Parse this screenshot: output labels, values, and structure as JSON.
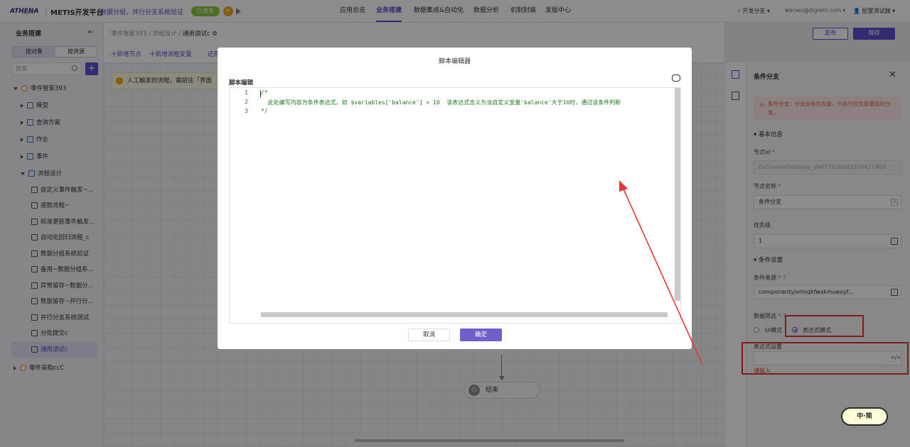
{
  "header": {
    "logo_text": "ATHENA",
    "logo_sub": "DigiWin",
    "platform": "METIS开发平台",
    "subtitle": "数据分组，并行分支系统验证",
    "status_badge": "已发布",
    "nav": [
      "应用总览",
      "业务搭建",
      "数据集成&自动化",
      "数据分析",
      "机制封装",
      "发版中心"
    ],
    "active_nav": "业务搭建",
    "branch": "开发分支",
    "user_email": "wenwu@digiwin.com",
    "tester": "配置测试器"
  },
  "sidebar": {
    "title": "业务搭建",
    "seg_a": "按对象",
    "seg_b": "按资源",
    "search_placeholder": "搜索",
    "root": "零件管家393",
    "items": [
      {
        "label": "模型"
      },
      {
        "label": "查询方案"
      },
      {
        "label": "作业"
      },
      {
        "label": "事件"
      },
      {
        "label": "流程设计"
      }
    ],
    "flows": [
      "自定义事件触发~...",
      "退数流程~",
      "标准更新事件触发...",
      "自动化回归流程_c",
      "数据分组系统验证",
      "备用~数据分组系...",
      "异常留存~数据分...",
      "数据留存~并行分...",
      "并行分支系统测试",
      "分批提交c",
      "通用调试c"
    ],
    "selected_flow": "通用调试c",
    "root2": "零件采购ccC"
  },
  "main": {
    "breadcrumb_1": "零件管家393",
    "breadcrumb_2": "流程设计",
    "breadcrumb_3": "通用调试c",
    "add_node": "十新增节点",
    "add_var": "十新增流程变量",
    "more_link": "还原",
    "warn_text": "人工触发的流程，需前往「界面",
    "end_node": "结束",
    "publish_btn": "发布",
    "save_btn": "保存"
  },
  "panel": {
    "title": "条件分支",
    "warning": "条件分支：分支间有优先级，只执行优先级最高的分支。",
    "basic_info": "基本信息",
    "node_id_label": "节点id",
    "node_id": "ExclusiveGateway_dfef7703bb85200421989",
    "node_name_label": "节点名称",
    "node_name": "条件分支",
    "priority_label": "优先级",
    "priority": "1",
    "cond_settings": "条件设置",
    "cond_source_label": "条件来源",
    "cond_source": "componentyjvrmqkfwxkmueoyf...",
    "filter_label": "数据筛选",
    "mode_ui": "UI模式",
    "mode_expr": "表达式模式",
    "expr_label": "表达式设置",
    "expr_hint": "请输入"
  },
  "dialog": {
    "title": "脚本编辑器",
    "section": "脚本编辑",
    "line_numbers": [
      "1",
      "2",
      "3"
    ],
    "code_lines": [
      "/*",
      "  此处编写内容为条件表达式，如 $variables['balance'] > 10  该表达式含义为当自定义变量'balance'大于10时，通过该条件判断",
      "*/"
    ],
    "cancel": "取消",
    "ok": "确定"
  },
  "widget": {
    "label": "中·简"
  },
  "colors": {
    "accent": "#5a4fcf",
    "annotation": "#e53935"
  }
}
